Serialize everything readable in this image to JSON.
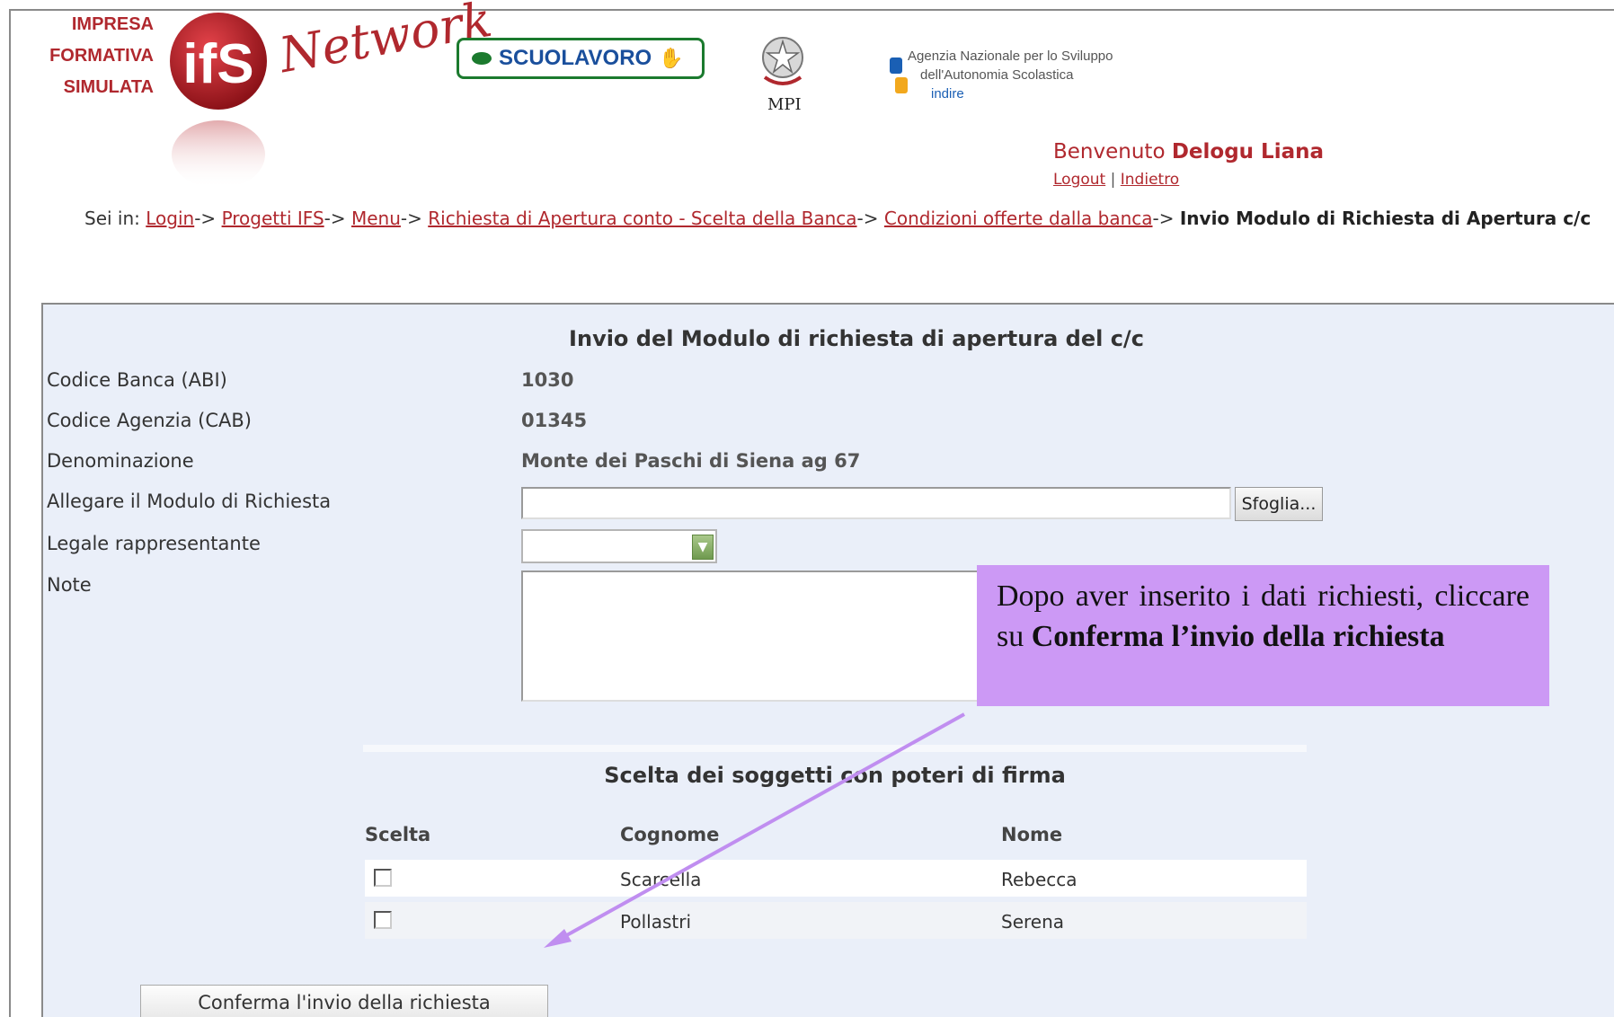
{
  "header": {
    "ifs_lines": [
      "IMPRESA",
      "FORMATIVA",
      "SIMULATA"
    ],
    "ifs_logo_text": "ifS",
    "network_text": "Network",
    "scuolavoro_text": "SCUOLAVORO",
    "mpi_label": "MPI",
    "indire_lines": [
      "Agenzia Nazionale per lo Sviluppo",
      "dell'Autonomia Scolastica",
      "indire"
    ],
    "welcome_prefix": "Benvenuto",
    "welcome_user": "Delogu Liana",
    "logout_label": "Logout",
    "link_separator": "|",
    "back_label": "Indietro"
  },
  "breadcrumb": {
    "prefix": "Sei in:",
    "items": [
      "Login",
      "Progetti IFS",
      "Menu",
      "Richiesta di Apertura conto - Scelta della Banca",
      "Condizioni offerte dalla banca"
    ],
    "separator": "->",
    "current": "Invio Modulo di Richiesta di Apertura c/c"
  },
  "form": {
    "title": "Invio del Modulo di richiesta di apertura del c/c",
    "rows": [
      {
        "label": "Codice Banca (ABI)",
        "value": "1030"
      },
      {
        "label": "Codice Agenzia (CAB)",
        "value": "01345"
      },
      {
        "label": "Denominazione",
        "value": "Monte dei Paschi di Siena ag 67"
      },
      {
        "label": "Allegare il Modulo di Richiesta",
        "value": ""
      },
      {
        "label": "Legale rappresentante",
        "value": ""
      },
      {
        "label": "Note",
        "value": ""
      }
    ],
    "browse_label": "Sfoglia...",
    "select_value": "",
    "note_value": ""
  },
  "signers": {
    "title": "Scelta dei soggetti con poteri di firma",
    "columns": [
      "Scelta",
      "Cognome",
      "Nome"
    ],
    "rows": [
      {
        "checked": false,
        "cognome": "Scarcella",
        "nome": "Rebecca"
      },
      {
        "checked": false,
        "cognome": "Pollastri",
        "nome": "Serena"
      }
    ]
  },
  "confirm_label": "Conferma l'invio della richiesta",
  "callout": {
    "text_before": "Dopo aver inserito i dati richiesti, cliccare su ",
    "text_bold": "Conferma l’invio della richiesta"
  },
  "colors": {
    "brand_red": "#b0282e",
    "panel_bg": "#eaeff9",
    "callout_bg": "#cc99f5",
    "arrow": "#c08ef0"
  }
}
